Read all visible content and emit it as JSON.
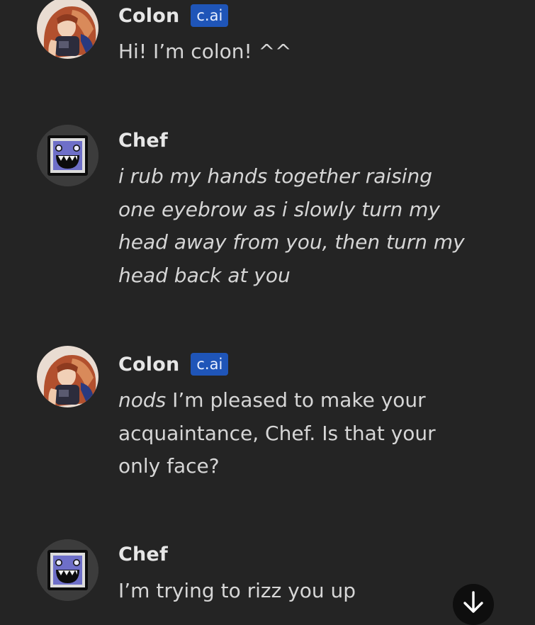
{
  "messages": [
    {
      "author": "Colon",
      "badge": "c.ai",
      "text": "Hi! I’m colon! ^^"
    },
    {
      "author": "Chef",
      "text": "i rub my hands together raising one eyebrow as i slowly turn my head away from you, then turn my head back at you"
    },
    {
      "author": "Colon",
      "badge": "c.ai",
      "text_emphasis": "nods",
      "text": " I’m pleased to make your acquaintance, Chef. Is that your only face?"
    },
    {
      "author": "Chef",
      "text": "I’m trying to rizz you up"
    }
  ],
  "icons": {
    "colon_avatar": "anime-character-avatar",
    "chef_avatar": "geometry-dash-monster-icon",
    "scroll_button": "arrow-down-icon"
  },
  "colors": {
    "background": "#242424",
    "badge": "#1f55b8",
    "text": "#d6d6d6"
  }
}
